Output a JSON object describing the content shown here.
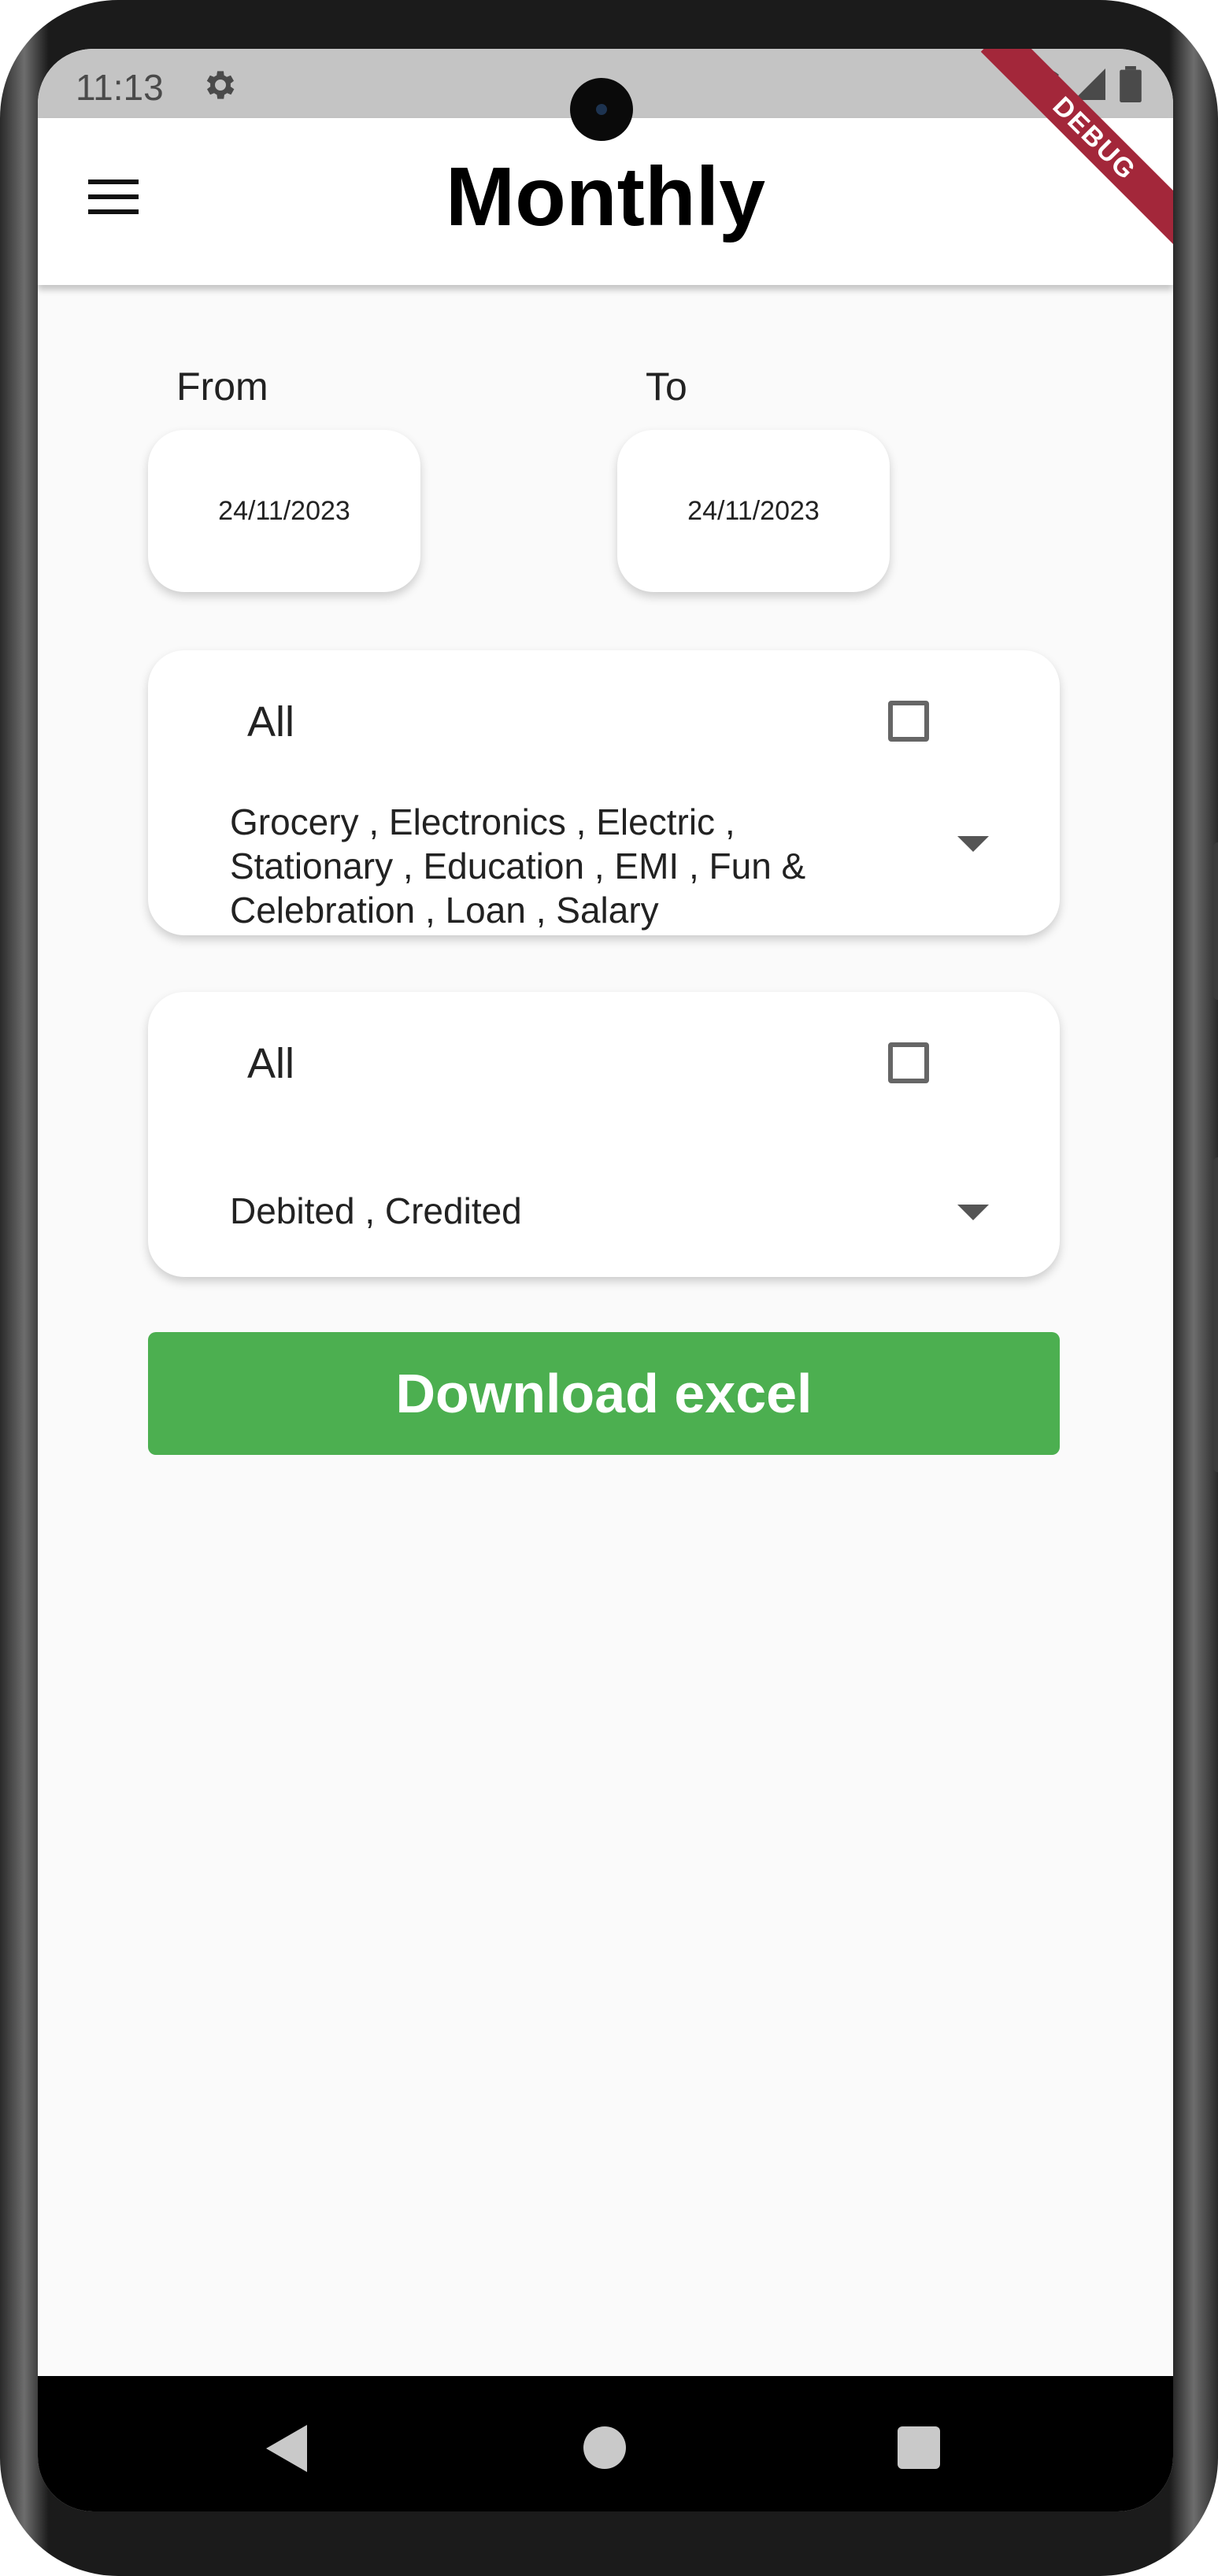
{
  "status_bar": {
    "time": "11:13",
    "icons": [
      "settings-icon",
      "wifi-icon",
      "signal-icon",
      "battery-icon"
    ]
  },
  "app_bar": {
    "title": "Monthly",
    "menu_icon": "hamburger-menu-icon",
    "debug_banner": "DEBUG"
  },
  "date_range": {
    "from_label": "From",
    "from_value": "24/11/2023",
    "to_label": "To",
    "to_value": "24/11/2023"
  },
  "category_filter": {
    "all_label": "All",
    "all_checked": false,
    "selected_text": "Grocery , Electronics , Electric , Stationary , Education , EMI , Fun & Celebration , Loan , Salary"
  },
  "type_filter": {
    "all_label": "All",
    "all_checked": false,
    "selected_text": "Debited , Credited"
  },
  "download_button": {
    "label": "Download excel",
    "color": "#4caf50"
  },
  "nav_bar": {
    "icons": [
      "back-icon",
      "home-icon",
      "recents-icon"
    ]
  }
}
